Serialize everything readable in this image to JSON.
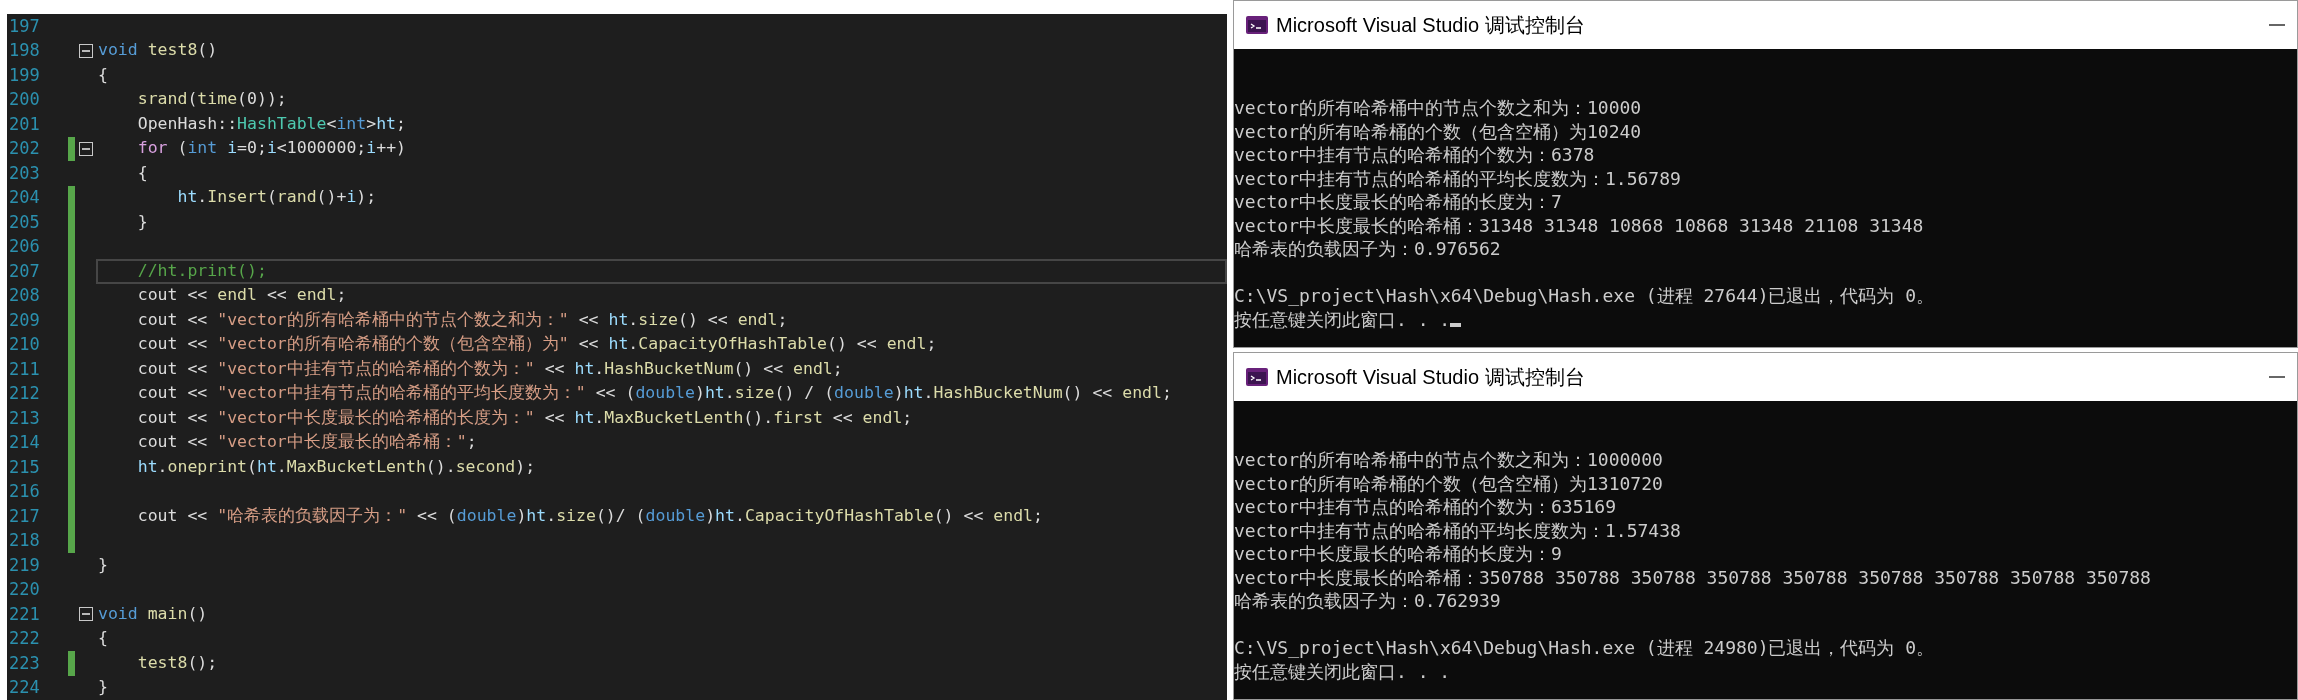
{
  "editor": {
    "lines": [
      {
        "number": "197",
        "changed": false,
        "current": false
      },
      {
        "number": "198",
        "changed": false,
        "current": false,
        "expanded": true,
        "kind": "top",
        "tokens": [
          {
            "kind": "keyword",
            "text": "void "
          },
          {
            "kind": "func",
            "text": "test8"
          },
          {
            "kind": "plain",
            "text": "()"
          }
        ]
      },
      {
        "number": "199",
        "changed": false,
        "current": false,
        "kind": "top",
        "tokens": [
          {
            "kind": "plain",
            "text": "{"
          }
        ]
      },
      {
        "number": "200",
        "changed": false,
        "current": false,
        "kind": "inner",
        "tokens": [
          {
            "kind": "func",
            "text": "srand"
          },
          {
            "kind": "plain",
            "text": "("
          },
          {
            "kind": "func",
            "text": "time"
          },
          {
            "kind": "plain",
            "text": "(0));"
          }
        ]
      },
      {
        "number": "201",
        "changed": false,
        "current": false,
        "kind": "inner",
        "tokens": [
          {
            "kind": "plain",
            "text": "OpenHash::"
          },
          {
            "kind": "type",
            "text": "HashTable"
          },
          {
            "kind": "plain",
            "text": "<"
          },
          {
            "kind": "keyword",
            "text": "int"
          },
          {
            "kind": "plain",
            "text": ">"
          },
          {
            "kind": "var",
            "text": "ht"
          },
          {
            "kind": "plain",
            "text": ";"
          }
        ]
      },
      {
        "number": "202",
        "changed": true,
        "current": false,
        "expanded": true,
        "kind": "inner",
        "tokens": [
          {
            "kind": "control",
            "text": "for"
          },
          {
            "kind": "plain",
            "text": " ("
          },
          {
            "kind": "keyword",
            "text": "int "
          },
          {
            "kind": "var",
            "text": "i"
          },
          {
            "kind": "plain",
            "text": "=0;"
          },
          {
            "kind": "var",
            "text": "i"
          },
          {
            "kind": "plain",
            "text": "<1000000;"
          },
          {
            "kind": "var",
            "text": "i"
          },
          {
            "kind": "plain",
            "text": "++)"
          }
        ]
      },
      {
        "number": "203",
        "changed": false,
        "current": false,
        "kind": "inner",
        "tokens": [
          {
            "kind": "plain",
            "text": "{"
          }
        ]
      },
      {
        "number": "204",
        "changed": true,
        "current": false,
        "kind": "nested",
        "tokens": [
          {
            "kind": "var",
            "text": "ht"
          },
          {
            "kind": "plain",
            "text": "."
          },
          {
            "kind": "func",
            "text": "Insert"
          },
          {
            "kind": "plain",
            "text": "("
          },
          {
            "kind": "func",
            "text": "rand"
          },
          {
            "kind": "plain",
            "text": "()+"
          },
          {
            "kind": "var",
            "text": "i"
          },
          {
            "kind": "plain",
            "text": ");"
          }
        ]
      },
      {
        "number": "205",
        "changed": true,
        "current": false,
        "kind": "inner",
        "tokens": [
          {
            "kind": "plain",
            "text": "}"
          }
        ]
      },
      {
        "number": "206",
        "changed": true,
        "current": false
      },
      {
        "number": "207",
        "changed": true,
        "current": true,
        "kind": "inner",
        "tokens": [
          {
            "kind": "comment",
            "text": "//ht.print();"
          }
        ]
      },
      {
        "number": "208",
        "changed": true,
        "current": false,
        "kind": "inner",
        "tokens": [
          {
            "kind": "plain",
            "text": "cout << "
          },
          {
            "kind": "func",
            "text": "endl"
          },
          {
            "kind": "plain",
            "text": " << "
          },
          {
            "kind": "func",
            "text": "endl"
          },
          {
            "kind": "plain",
            "text": ";"
          }
        ]
      },
      {
        "number": "209",
        "changed": true,
        "current": false,
        "kind": "inner",
        "tokens": [
          {
            "kind": "plain",
            "text": "cout << "
          },
          {
            "kind": "string",
            "text": "\"vector的所有哈希桶中的节点个数之和为：\""
          },
          {
            "kind": "plain",
            "text": " << "
          },
          {
            "kind": "var",
            "text": "ht"
          },
          {
            "kind": "plain",
            "text": "."
          },
          {
            "kind": "func",
            "text": "size"
          },
          {
            "kind": "plain",
            "text": "() << "
          },
          {
            "kind": "func",
            "text": "endl"
          },
          {
            "kind": "plain",
            "text": ";"
          }
        ]
      },
      {
        "number": "210",
        "changed": true,
        "current": false,
        "kind": "inner",
        "tokens": [
          {
            "kind": "plain",
            "text": "cout << "
          },
          {
            "kind": "string",
            "text": "\"vector的所有哈希桶的个数（包含空桶）为\""
          },
          {
            "kind": "plain",
            "text": " << "
          },
          {
            "kind": "var",
            "text": "ht"
          },
          {
            "kind": "plain",
            "text": "."
          },
          {
            "kind": "func",
            "text": "CapacityOfHashTable"
          },
          {
            "kind": "plain",
            "text": "() << "
          },
          {
            "kind": "func",
            "text": "endl"
          },
          {
            "kind": "plain",
            "text": ";"
          }
        ]
      },
      {
        "number": "211",
        "changed": true,
        "current": false,
        "kind": "inner",
        "tokens": [
          {
            "kind": "plain",
            "text": "cout << "
          },
          {
            "kind": "string",
            "text": "\"vector中挂有节点的哈希桶的个数为：\""
          },
          {
            "kind": "plain",
            "text": " << "
          },
          {
            "kind": "var",
            "text": "ht"
          },
          {
            "kind": "plain",
            "text": "."
          },
          {
            "kind": "func",
            "text": "HashBucketNum"
          },
          {
            "kind": "plain",
            "text": "() << "
          },
          {
            "kind": "func",
            "text": "endl"
          },
          {
            "kind": "plain",
            "text": ";"
          }
        ]
      },
      {
        "number": "212",
        "changed": true,
        "current": false,
        "kind": "inner",
        "tokens": [
          {
            "kind": "plain",
            "text": "cout << "
          },
          {
            "kind": "string",
            "text": "\"vector中挂有节点的哈希桶的平均长度数为：\""
          },
          {
            "kind": "plain",
            "text": " << ("
          },
          {
            "kind": "keyword",
            "text": "double"
          },
          {
            "kind": "plain",
            "text": ")"
          },
          {
            "kind": "var",
            "text": "ht"
          },
          {
            "kind": "plain",
            "text": "."
          },
          {
            "kind": "func",
            "text": "size"
          },
          {
            "kind": "plain",
            "text": "() / ("
          },
          {
            "kind": "keyword",
            "text": "double"
          },
          {
            "kind": "plain",
            "text": ")"
          },
          {
            "kind": "var",
            "text": "ht"
          },
          {
            "kind": "plain",
            "text": "."
          },
          {
            "kind": "func",
            "text": "HashBucketNum"
          },
          {
            "kind": "plain",
            "text": "() << "
          },
          {
            "kind": "func",
            "text": "endl"
          },
          {
            "kind": "plain",
            "text": ";"
          }
        ]
      },
      {
        "number": "213",
        "changed": true,
        "current": false,
        "kind": "inner",
        "tokens": [
          {
            "kind": "plain",
            "text": "cout << "
          },
          {
            "kind": "string",
            "text": "\"vector中长度最长的哈希桶的长度为：\""
          },
          {
            "kind": "plain",
            "text": " << "
          },
          {
            "kind": "var",
            "text": "ht"
          },
          {
            "kind": "plain",
            "text": "."
          },
          {
            "kind": "func",
            "text": "MaxBucketLenth"
          },
          {
            "kind": "plain",
            "text": "()."
          },
          {
            "kind": "func",
            "text": "first"
          },
          {
            "kind": "plain",
            "text": " << "
          },
          {
            "kind": "func",
            "text": "endl"
          },
          {
            "kind": "plain",
            "text": ";"
          }
        ]
      },
      {
        "number": "214",
        "changed": true,
        "current": false,
        "kind": "inner",
        "tokens": [
          {
            "kind": "plain",
            "text": "cout << "
          },
          {
            "kind": "string",
            "text": "\"vector中长度最长的哈希桶：\""
          },
          {
            "kind": "plain",
            "text": ";"
          }
        ]
      },
      {
        "number": "215",
        "changed": true,
        "current": false,
        "kind": "inner",
        "tokens": [
          {
            "kind": "var",
            "text": "ht"
          },
          {
            "kind": "plain",
            "text": "."
          },
          {
            "kind": "func",
            "text": "oneprint"
          },
          {
            "kind": "plain",
            "text": "("
          },
          {
            "kind": "var",
            "text": "ht"
          },
          {
            "kind": "plain",
            "text": "."
          },
          {
            "kind": "func",
            "text": "MaxBucketLenth"
          },
          {
            "kind": "plain",
            "text": "()."
          },
          {
            "kind": "func",
            "text": "second"
          },
          {
            "kind": "plain",
            "text": ");"
          }
        ]
      },
      {
        "number": "216",
        "changed": true,
        "current": false
      },
      {
        "number": "217",
        "changed": true,
        "current": false,
        "kind": "inner",
        "tokens": [
          {
            "kind": "plain",
            "text": "cout << "
          },
          {
            "kind": "string",
            "text": "\"哈希表的负载因子为：\""
          },
          {
            "kind": "plain",
            "text": " << ("
          },
          {
            "kind": "keyword",
            "text": "double"
          },
          {
            "kind": "plain",
            "text": ")"
          },
          {
            "kind": "var",
            "text": "ht"
          },
          {
            "kind": "plain",
            "text": "."
          },
          {
            "kind": "func",
            "text": "size"
          },
          {
            "kind": "plain",
            "text": "()/ ("
          },
          {
            "kind": "keyword",
            "text": "double"
          },
          {
            "kind": "plain",
            "text": ")"
          },
          {
            "kind": "var",
            "text": "ht"
          },
          {
            "kind": "plain",
            "text": "."
          },
          {
            "kind": "func",
            "text": "CapacityOfHashTable"
          },
          {
            "kind": "plain",
            "text": "() << "
          },
          {
            "kind": "func",
            "text": "endl"
          },
          {
            "kind": "plain",
            "text": ";"
          }
        ]
      },
      {
        "number": "218",
        "changed": true,
        "current": false
      },
      {
        "number": "219",
        "changed": false,
        "current": false,
        "kind": "top",
        "tokens": [
          {
            "kind": "plain",
            "text": "}"
          }
        ]
      },
      {
        "number": "220",
        "changed": false,
        "current": false
      },
      {
        "number": "221",
        "changed": false,
        "current": false,
        "expanded": true,
        "kind": "top",
        "tokens": [
          {
            "kind": "keyword",
            "text": "void "
          },
          {
            "kind": "func",
            "text": "main"
          },
          {
            "kind": "plain",
            "text": "()"
          }
        ]
      },
      {
        "number": "222",
        "changed": false,
        "current": false,
        "kind": "top",
        "tokens": [
          {
            "kind": "plain",
            "text": "{"
          }
        ]
      },
      {
        "number": "223",
        "changed": true,
        "current": false,
        "kind": "inner",
        "tokens": [
          {
            "kind": "func",
            "text": "test8"
          },
          {
            "kind": "plain",
            "text": "();"
          }
        ]
      },
      {
        "number": "224",
        "changed": false,
        "current": false,
        "kind": "top",
        "tokens": [
          {
            "kind": "plain",
            "text": "}"
          }
        ]
      }
    ]
  },
  "consoles": [
    {
      "title": "Microsoft Visual Studio 调试控制台",
      "cursor": true,
      "output": [
        "vector的所有哈希桶中的节点个数之和为：10000",
        "vector的所有哈希桶的个数（包含空桶）为10240",
        "vector中挂有节点的哈希桶的个数为：6378",
        "vector中挂有节点的哈希桶的平均长度数为：1.56789",
        "vector中长度最长的哈希桶的长度为：7",
        "vector中长度最长的哈希桶：31348 31348 10868 10868 31348 21108 31348",
        "哈希表的负载因子为：0.976562"
      ],
      "exit_message": "C:\\VS_project\\Hash\\x64\\Debug\\Hash.exe (进程 27644)已退出，代码为 0。",
      "prompt": "按任意键关闭此窗口. . ."
    },
    {
      "title": "Microsoft Visual Studio 调试控制台",
      "cursor": false,
      "output": [
        "vector的所有哈希桶中的节点个数之和为：1000000",
        "vector的所有哈希桶的个数（包含空桶）为1310720",
        "vector中挂有节点的哈希桶的个数为：635169",
        "vector中挂有节点的哈希桶的平均长度数为：1.57438",
        "vector中长度最长的哈希桶的长度为：9",
        "vector中长度最长的哈希桶：350788 350788 350788 350788 350788 350788 350788 350788 350788",
        "哈希表的负载因子为：0.762939"
      ],
      "exit_message": "C:\\VS_project\\Hash\\x64\\Debug\\Hash.exe (进程 24980)已退出，代码为 0。",
      "prompt": "按任意键关闭此窗口. . ."
    }
  ]
}
